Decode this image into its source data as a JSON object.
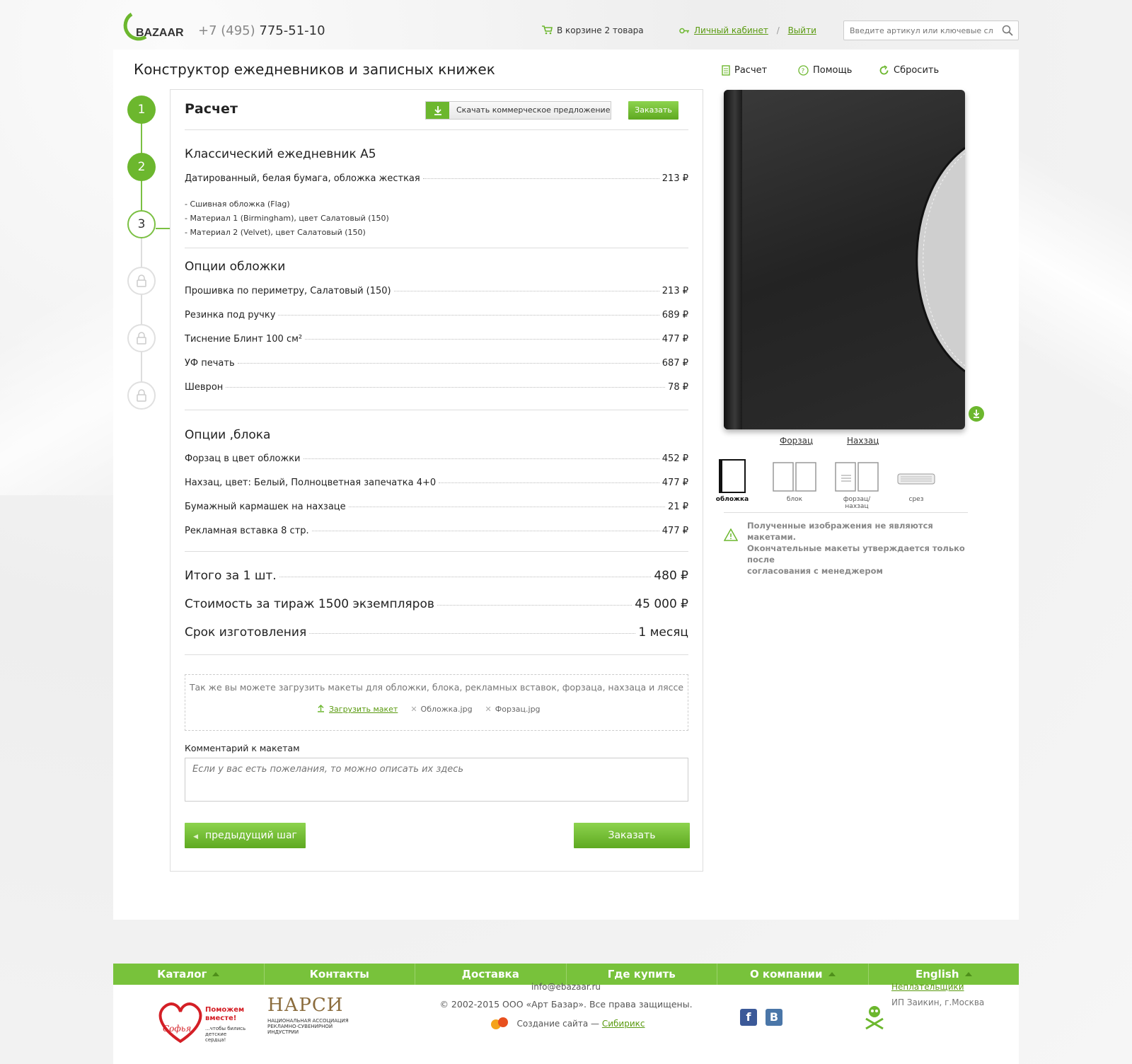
{
  "header": {
    "logo_text": "BAZAAR",
    "phone_prefix": "+7 (495)",
    "phone_number": "775-51-10",
    "cart_text": "В корзине 2 товара",
    "account_link": "Личный кабинет",
    "separator": "/",
    "logout_link": "Выйти",
    "search_placeholder": "Введите артикул или ключевые слова"
  },
  "page": {
    "title": "Конструктор ежедневников и записных книжек",
    "actions": {
      "calc": "Расчет",
      "help": "Помощь",
      "reset": "Сбросить"
    }
  },
  "steps": [
    "1",
    "2",
    "3"
  ],
  "panel": {
    "title": "Расчет",
    "download_label": "Скачать коммерческое предложение",
    "order_label": "Заказать",
    "product": {
      "name": "Классический ежедневник А5",
      "line": "Датированный, белая бумага, обложка жесткая",
      "price": "213 ₽",
      "notes": [
        "- Сшивная обложка (Flag)",
        "- Материал 1 (Birmingham), цвет Салатовый (150)",
        "- Материал 2 (Velvet), цвет Салатовый (150)"
      ]
    },
    "cover_options": {
      "title": "Опции обложки",
      "items": [
        {
          "label": "Прошивка по периметру, Салатовый (150)",
          "price": "213 ₽"
        },
        {
          "label": "Резинка под ручку",
          "price": "689 ₽"
        },
        {
          "label": "Тиснение Блинт 100 см²",
          "price": "477 ₽"
        },
        {
          "label": "УФ печать",
          "price": "687 ₽"
        },
        {
          "label": "Шеврон",
          "price": "78 ₽"
        }
      ]
    },
    "block_options": {
      "title": "Опции ,блока",
      "items": [
        {
          "label": "Форзац в цвет обложки",
          "price": "452 ₽"
        },
        {
          "label": "Нахзац, цвет: Белый, Полноцветная запечатка 4+0",
          "price": "477 ₽"
        },
        {
          "label": "Бумажный кармашек на нахзаце",
          "price": "21 ₽"
        },
        {
          "label": "Рекламная вставка 8 стр.",
          "price": "477 ₽"
        }
      ]
    },
    "totals": [
      {
        "label": "Итого за 1 шт.",
        "value": "480 ₽"
      },
      {
        "label": "Стоимость за тираж 1500 экземпляров",
        "value": "45 000 ₽"
      },
      {
        "label": "Срок изготовления",
        "value": "1 месяц"
      }
    ],
    "upload": {
      "text": "Так же вы можете загрузить макеты для обложки, блока, рекламных вставок, форзаца, нахзаца и ляссе",
      "link": "Загрузить макет",
      "files": [
        "Обложка.jpg",
        "Форзац.jpg"
      ]
    },
    "comment": {
      "label": "Комментарий к макетам",
      "placeholder": "Если у вас есть пожелания, то можно описать их здесь"
    },
    "prev_label": "предыдущий шаг",
    "order_bottom": "Заказать"
  },
  "preview": {
    "tabs": [
      "Форзац",
      "Нахзац"
    ],
    "thumbs": [
      "обложка",
      "блок",
      "форзац/нахзац",
      "срез"
    ],
    "selected_thumb": "обложка",
    "warning": [
      "Полученные изображения не являются макетами.",
      "Окончательные макеты утверждается только после",
      "согласования с менеджером"
    ]
  },
  "footer_nav": [
    {
      "label": "Каталог",
      "arrow": true
    },
    {
      "label": "Контакты",
      "arrow": false
    },
    {
      "label": "Доставка",
      "arrow": false
    },
    {
      "label": "Где купить",
      "arrow": false
    },
    {
      "label": "О компании",
      "arrow": true
    },
    {
      "label": "English",
      "arrow": true
    }
  ],
  "footer": {
    "charity_title": "Поможем вместе!",
    "charity_sub": "...чтобы бились детские сердца!",
    "charity_logo": "Софья",
    "narsi": "НАРСИ",
    "narsi_sub": "НАЦИОНАЛЬНАЯ АССОЦИАЦИЯ РЕКЛАМНО-СУВЕНИРНОЙ ИНДУСТРИИ",
    "email": "info@ebazaar.ru",
    "copyright": "© 2002-2015 ООО «Арт Базар». Все права защищены.",
    "created_prefix": "Создание сайта —",
    "created_link": "Сибирикс",
    "social": [
      "f",
      "B"
    ],
    "nonpayers_link": "Неплательщики",
    "nonpayers_sub": "ИП Заикин, г.Москва"
  },
  "colors": {
    "accent": "#6cb72e",
    "link": "#5a9a10",
    "footer_bar": "#78c23b"
  }
}
